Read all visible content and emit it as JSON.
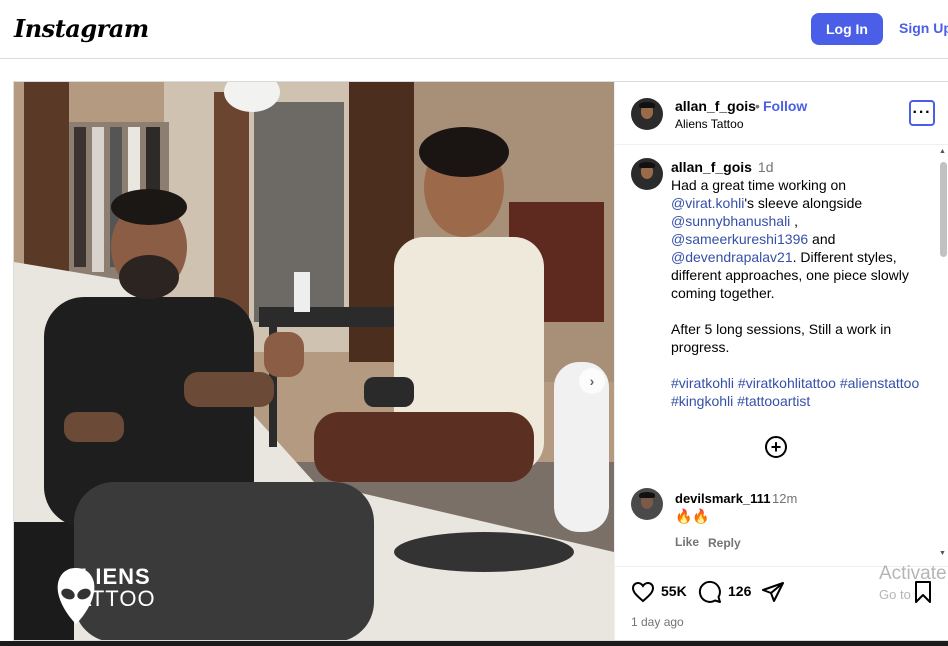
{
  "topbar": {
    "logo": "Instagram",
    "login_label": "Log In",
    "signup_label": "Sign Up"
  },
  "photo": {
    "watermark_line1": "ALIENS",
    "watermark_line2": "TATTOO",
    "next_icon": "chevron-right-icon"
  },
  "post_header": {
    "username": "allan_f_gois",
    "separator": "•",
    "follow_label": "Follow",
    "location": "Aliens Tattoo",
    "more_icon": "more-options-icon"
  },
  "caption": {
    "username": "allan_f_gois",
    "time": "1d",
    "segments": [
      "Had a great time working on ",
      "@virat.kohli",
      "'s sleeve alongside ",
      "@sunnybhanushali",
      " , ",
      "@sameerkureshi1396",
      " and ",
      "@devendrapalav21",
      ". Different styles, different approaches, one piece slowly coming together."
    ],
    "paragraph2": "After 5 long sessions, Still a work in progress.",
    "hashtags": "#viratkohli #viratkohlitattoo #alienstattoo #kingkohli #tattooartist"
  },
  "load_more_icon": "plus-circle-icon",
  "comments": [
    {
      "username": "devilsmark_111",
      "time": "12m",
      "text": "🔥🔥",
      "like_label": "Like",
      "reply_label": "Reply"
    }
  ],
  "actions": {
    "likes": "55K",
    "comments": "126",
    "date": "1 day ago"
  },
  "overlay": {
    "activate_line1": "Activate",
    "activate_line2": "Go to"
  },
  "colors": {
    "accent": "#4a5ee8",
    "mention": "#3550a8",
    "muted": "#737373",
    "border": "#dbdbdb"
  }
}
